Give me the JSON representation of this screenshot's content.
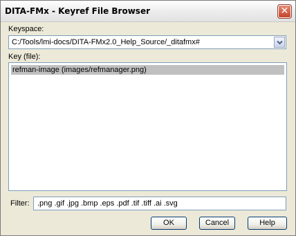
{
  "window": {
    "title": "DITA-FMx - Keyref File Browser",
    "close_symbol": "✕"
  },
  "keyspace": {
    "label": "Keyspace:",
    "value": "C:/Tools/lmi-docs/DITA-FMx2.0_Help_Source/_ditafmx#"
  },
  "keys": {
    "label": "Key (file):",
    "items": [
      {
        "label": "refman-image (images/refmanager.png)",
        "selected": true
      }
    ]
  },
  "filter": {
    "label": "Filter:",
    "value": ".png .gif .jpg .bmp .eps .pdf .tif .tiff .ai .svg"
  },
  "buttons": {
    "ok": "OK",
    "cancel": "Cancel",
    "help": "Help"
  },
  "colors": {
    "dialog_background": "#ece9d8",
    "selection_background": "#c0c0c0",
    "field_border": "#7f9db9",
    "close_button": "#c6432a"
  },
  "icons": {
    "combo_arrow": "chevron-down-icon",
    "close": "close-icon"
  }
}
